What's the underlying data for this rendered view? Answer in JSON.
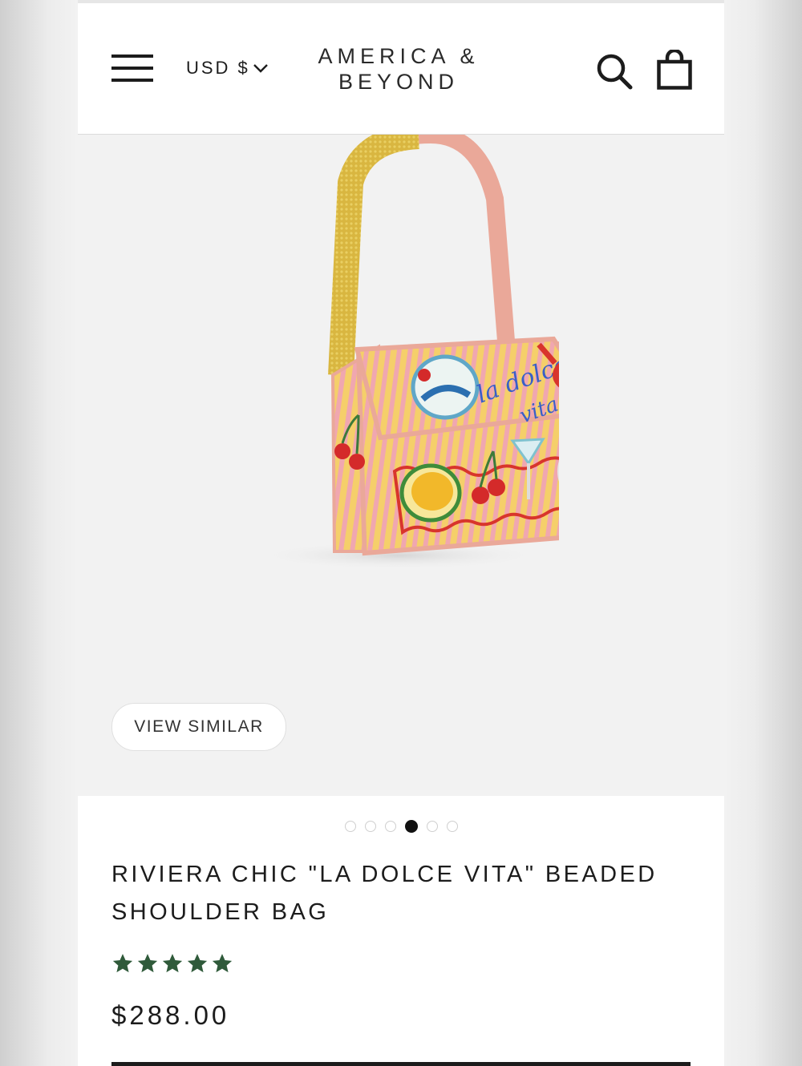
{
  "header": {
    "currency": "USD $",
    "brand_line1": "AMERICA &",
    "brand_line2": "BEYOND",
    "icons": [
      "menu-icon",
      "chevron-down-icon",
      "search-icon",
      "shopping-bag-icon"
    ]
  },
  "gallery": {
    "view_similar_label": "VIEW SIMILAR",
    "image_count": 6,
    "active_image_index": 3
  },
  "product": {
    "title": "RIVIERA CHIC \"LA DOLCE VITA\" BEADED SHOULDER BAG",
    "rating": 5,
    "rating_max": 5,
    "price": "$288.00"
  },
  "colors": {
    "star": "#2f5a3a",
    "text": "#1c1c1c",
    "gallery_bg": "#f2f2f2"
  }
}
